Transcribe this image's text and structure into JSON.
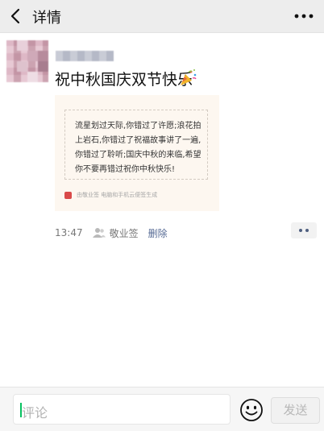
{
  "header": {
    "title": "详情",
    "back_icon": "chevron-left-icon",
    "more_icon": "more-dots-icon"
  },
  "post": {
    "text": "祝中秋国庆双节快乐",
    "emoji_icon": "party-popper-icon",
    "card": {
      "text": "流星划过天际,你错过了许愿;浪花拍上岩石,你错过了祝福故事讲了一遍,你错过了聆听;国庆中秋的来临,希望你不要再错过祝你中秋快乐!",
      "footer": "由敬业签 电脑和手机云便签生成",
      "accent": "#d94a4a"
    },
    "time": "13:47",
    "visibility_icon": "people-icon",
    "visibility": "敬业签",
    "delete_label": "删除",
    "comment_icon": "comment-dots-icon"
  },
  "input_bar": {
    "placeholder": "评论",
    "emoji_button_icon": "smiley-face-icon",
    "send_label": "发送"
  },
  "colors": {
    "link": "#576b95",
    "accent_green": "#07c160"
  }
}
